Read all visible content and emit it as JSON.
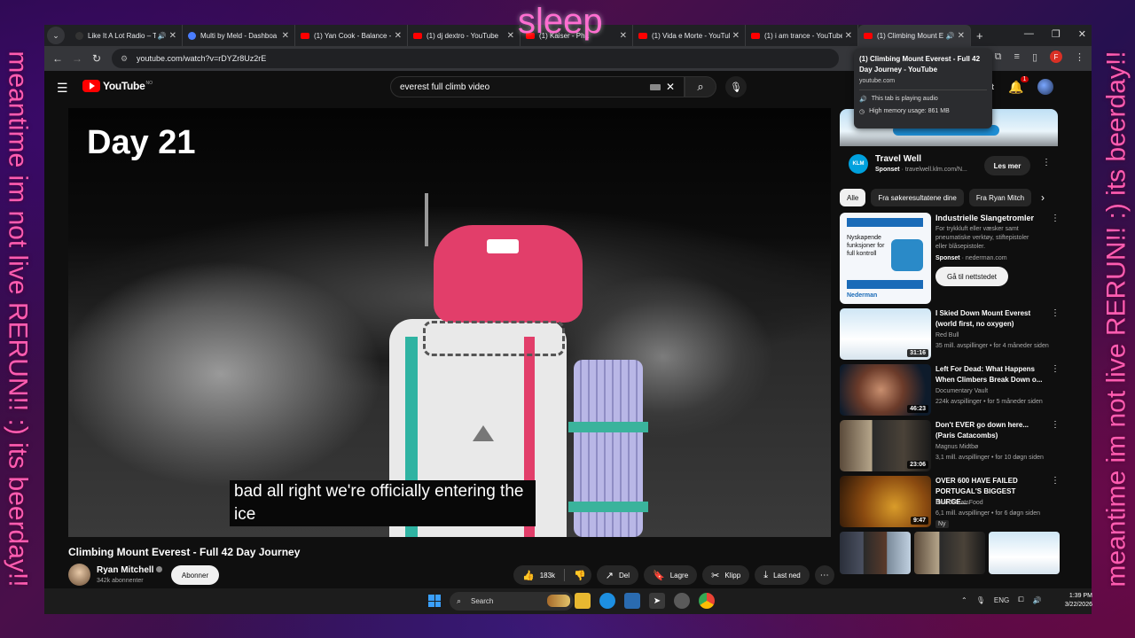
{
  "overlay": {
    "sleep_text": "sleep",
    "left_text": "meantime im not live RERUN!! :) its beerday!!",
    "right_text": "meantime im not live RERUN!! :) its beerday!!"
  },
  "browser": {
    "tabs": [
      {
        "title": "Like It A Lot Radio – T",
        "fav": "dark"
      },
      {
        "title": "Multi by Meld - Dashboa",
        "fav": "blue"
      },
      {
        "title": "(1) Yan Cook - Balance - Y",
        "fav": "red"
      },
      {
        "title": "(1) dj dextro - YouTube",
        "fav": "red"
      },
      {
        "title": "(1) Kaiser - Pha",
        "fav": "red"
      },
      {
        "title": "(1) Vida e Morte - YouTub",
        "fav": "red"
      },
      {
        "title": "(1) i am trance - YouTube",
        "fav": "red"
      },
      {
        "title": "(1) Climbing Mount E",
        "fav": "red",
        "active": true
      }
    ],
    "url": "youtube.com/watch?v=rDYZr8Uz2rE",
    "profile_initial": "F",
    "tooltip": {
      "title": "(1) Climbing Mount Everest - Full 42 Day Journey - YouTube",
      "domain": "youtube.com",
      "audio": "This tab is playing audio",
      "memory": "High memory usage: 861 MB"
    }
  },
  "youtube": {
    "logo": "YouTube",
    "logo_region": "NO",
    "search_query": "everest full climb video",
    "create_label": "ett",
    "notif_count": "1",
    "video": {
      "overlay_title": "Day 21",
      "subtitle": "bad all right we're officially entering the ice",
      "title": "Climbing Mount Everest - Full 42 Day Journey",
      "channel": "Ryan Mitchell",
      "subscribers": "342k abonnenter",
      "subscribe_label": "Abonner",
      "likes": "183k",
      "share": "Del",
      "save": "Lagre",
      "clip": "Klipp",
      "download": "Last ned"
    },
    "ad1": {
      "title": "Travel Well",
      "sponsored": "Sponset",
      "url": "travelwell.klm.com/N...",
      "button": "Les mer",
      "logo": "KLM"
    },
    "chips": [
      "Alle",
      "Fra søkeresultatene dine",
      "Fra Ryan Mitch"
    ],
    "ad2": {
      "title": "Industrielle Slangetromler",
      "desc": "For trykkluft eller væsker samt pneumatiske verktøy, stiftepistoler eller blåsepistoler.",
      "sponsored": "Sponset",
      "domain": "nederman.com",
      "button": "Gå til nettstedet",
      "img_text": "Nyskapende funksjoner for full kontroll",
      "img_brand": "Nederman"
    },
    "recs": [
      {
        "title": "I Skied Down Mount Everest (world first, no oxygen)",
        "channel": "Red Bull",
        "meta": "35 mill. avspillinger • for 4 måneder siden",
        "duration": "31:16",
        "thumb": "t1"
      },
      {
        "title": "Left For Dead: What Happens When Climbers Break Down o...",
        "channel": "Documentary Vault",
        "meta": "224k avspillinger • for 5 måneder siden",
        "duration": "46:23",
        "thumb": "t2"
      },
      {
        "title": "Don't EVER go down here... (Paris Catacombs)",
        "channel": "Magnus Midtbø",
        "meta": "3,1 mill. avspillinger • for 10 døgn siden",
        "duration": "23:06",
        "thumb": "t3"
      },
      {
        "title": "OVER 600 HAVE FAILED PORTUGAL'S BIGGEST BURGE...",
        "channel": "BeardMeatsFood",
        "meta": "6,1 mill. avspillinger • for 6 døgn siden",
        "duration": "9:47",
        "thumb": "t4",
        "badge": "Ny"
      }
    ]
  },
  "taskbar": {
    "search": "Search",
    "lang": "ENG",
    "time": "1:39 PM",
    "date": "3/22/2026"
  }
}
